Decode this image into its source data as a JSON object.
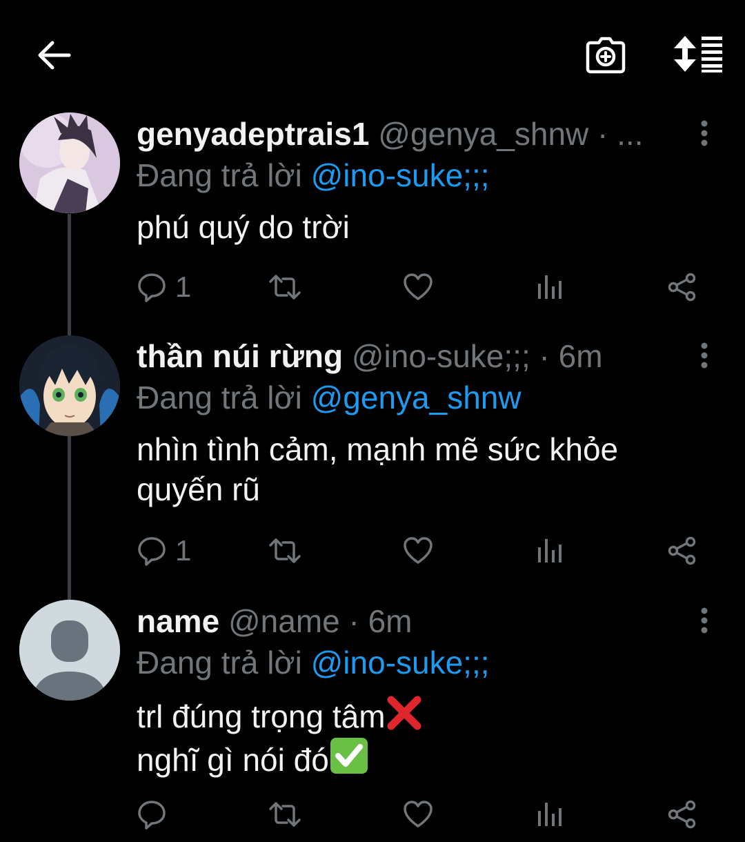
{
  "topbar": {
    "back_icon": "arrow-left-icon",
    "camera_icon": "camera-plus-icon",
    "sort_icon": "sort-list-icon"
  },
  "colors": {
    "background": "#000000",
    "muted": "#71767b",
    "link": "#1d9bf0",
    "text": "#f0f2f3"
  },
  "tweets": [
    {
      "display_name": "genyadeptrais1",
      "handle": "@genya_shnw",
      "meta": "· ...",
      "reply_prefix": "Đang trả lời",
      "reply_to": "@ino-suke;;;",
      "body_lines": [
        "phú quý do trời"
      ],
      "reply_count": "1"
    },
    {
      "display_name": "thần núi rừng",
      "handle": "@ino-suke;;;",
      "meta": "· 6m",
      "reply_prefix": "Đang trả lời",
      "reply_to": "@genya_shnw",
      "body_lines": [
        "nhìn tình cảm, mạnh mẽ sức khỏe",
        "quyến rũ"
      ],
      "reply_count": "1"
    },
    {
      "display_name": "name",
      "handle": "@name",
      "meta": "· 6m",
      "reply_prefix": "Đang trả lời",
      "reply_to": "@ino-suke;;;",
      "body_lines": [
        "trl đúng trọng tâm",
        "nghĩ gì nói đó"
      ],
      "body_emojis": [
        "cross-mark-emoji",
        "check-mark-emoji"
      ],
      "reply_count": ""
    }
  ]
}
